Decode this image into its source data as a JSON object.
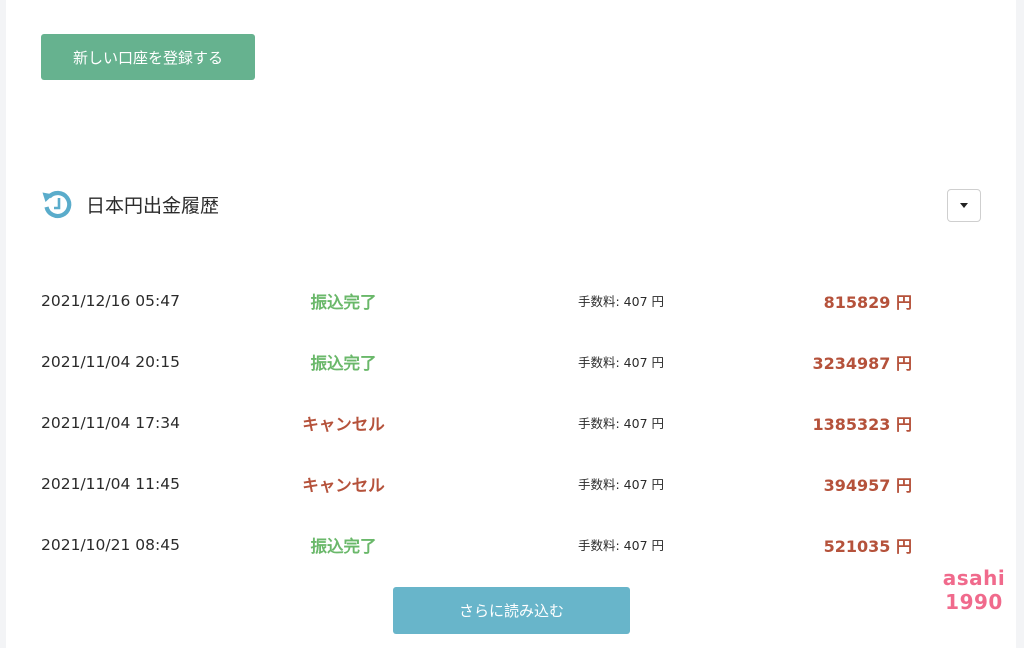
{
  "actions": {
    "register_label": "新しい口座を登録する",
    "load_more_label": "さらに読み込む"
  },
  "section": {
    "title": "日本円出金履歴",
    "icon": "history-icon"
  },
  "rows": [
    {
      "datetime": "2021/12/16 05:47",
      "status": "振込完了",
      "status_type": "done",
      "fee": "手数料: 407 円",
      "amount": "815829 円"
    },
    {
      "datetime": "2021/11/04 20:15",
      "status": "振込完了",
      "status_type": "done",
      "fee": "手数料: 407 円",
      "amount": "3234987 円"
    },
    {
      "datetime": "2021/11/04 17:34",
      "status": "キャンセル",
      "status_type": "cancel",
      "fee": "手数料: 407 円",
      "amount": "1385323 円"
    },
    {
      "datetime": "2021/11/04 11:45",
      "status": "キャンセル",
      "status_type": "cancel",
      "fee": "手数料: 407 円",
      "amount": "394957 円"
    },
    {
      "datetime": "2021/10/21 08:45",
      "status": "振込完了",
      "status_type": "done",
      "fee": "手数料: 407 円",
      "amount": "521035 円"
    }
  ],
  "watermark": {
    "line1": "asahi",
    "line2": "1990"
  },
  "colors": {
    "register_button": "#66b28f",
    "load_more_button": "#68b5ca",
    "status_done": "#6ab86a",
    "status_cancel": "#b5523b",
    "amount": "#b5523b",
    "icon": "#5aaccb",
    "watermark": "#f06a8c"
  }
}
